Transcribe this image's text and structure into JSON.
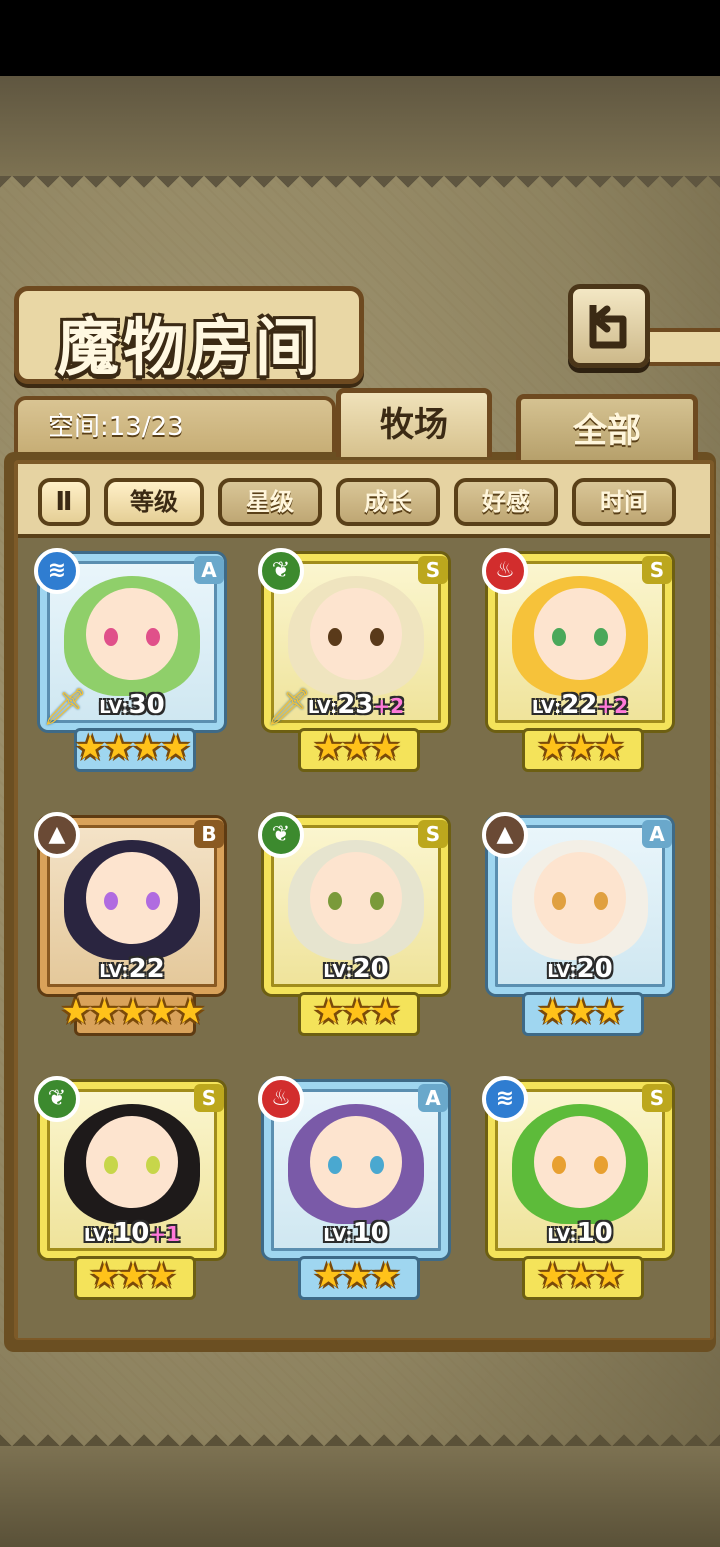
{
  "header": {
    "title": "魔物房间",
    "space_label": "空间:13/23",
    "back_icon_glyph": "↰"
  },
  "tabs": [
    {
      "label": "牧场",
      "selected": true
    },
    {
      "label": "全部",
      "selected": false
    }
  ],
  "sort": {
    "toggle_glyph": "Ⅱ",
    "buttons": [
      {
        "label": "等级",
        "active": true
      },
      {
        "label": "星级",
        "active": false
      },
      {
        "label": "成长",
        "active": false
      },
      {
        "label": "好感",
        "active": false
      },
      {
        "label": "时间",
        "active": false
      }
    ]
  },
  "monsters": [
    {
      "rank": "A",
      "element": "water",
      "element_glyph": "≋",
      "level": "30",
      "bonus": "",
      "stars": "★★★★",
      "has_sword": true,
      "hair": "#8fcf6a",
      "eye": "#e0508a"
    },
    {
      "rank": "S",
      "element": "wood",
      "element_glyph": "❦",
      "level": "23",
      "bonus": "+2",
      "stars": "★★★",
      "has_sword": true,
      "hair": "#efe4bf",
      "eye": "#5a3a1a"
    },
    {
      "rank": "S",
      "element": "fire",
      "element_glyph": "♨",
      "level": "22",
      "bonus": "+2",
      "stars": "★★★",
      "has_sword": false,
      "hair": "#f6c23a",
      "eye": "#4aa85a"
    },
    {
      "rank": "B",
      "element": "earth",
      "element_glyph": "▲",
      "level": "22",
      "bonus": "",
      "stars": "★★★★★",
      "has_sword": false,
      "hair": "#2a2540",
      "eye": "#b06be0"
    },
    {
      "rank": "S",
      "element": "wood",
      "element_glyph": "❦",
      "level": "20",
      "bonus": "",
      "stars": "★★★",
      "has_sword": false,
      "hair": "#e6e4cf",
      "eye": "#7a9a3a"
    },
    {
      "rank": "A",
      "element": "earth",
      "element_glyph": "▲",
      "level": "20",
      "bonus": "",
      "stars": "★★★",
      "has_sword": false,
      "hair": "#f3efe6",
      "eye": "#e0a040"
    },
    {
      "rank": "S",
      "element": "wood",
      "element_glyph": "❦",
      "level": "10",
      "bonus": "+1",
      "stars": "★★★",
      "has_sword": false,
      "hair": "#1e1a1a",
      "eye": "#c7d64a"
    },
    {
      "rank": "A",
      "element": "fire",
      "element_glyph": "♨",
      "level": "10",
      "bonus": "",
      "stars": "★★★",
      "has_sword": false,
      "hair": "#7a5aa8",
      "eye": "#4aa8d0"
    },
    {
      "rank": "S",
      "element": "water",
      "element_glyph": "≋",
      "level": "10",
      "bonus": "",
      "stars": "★★★",
      "has_sword": false,
      "hair": "#5dbb3a",
      "eye": "#e8a030"
    }
  ],
  "level_prefix": "LV:",
  "colors": {
    "water": "#2f7dd1",
    "wood": "#3c8a2e",
    "fire": "#d22d2d",
    "earth": "#6a4a35"
  }
}
